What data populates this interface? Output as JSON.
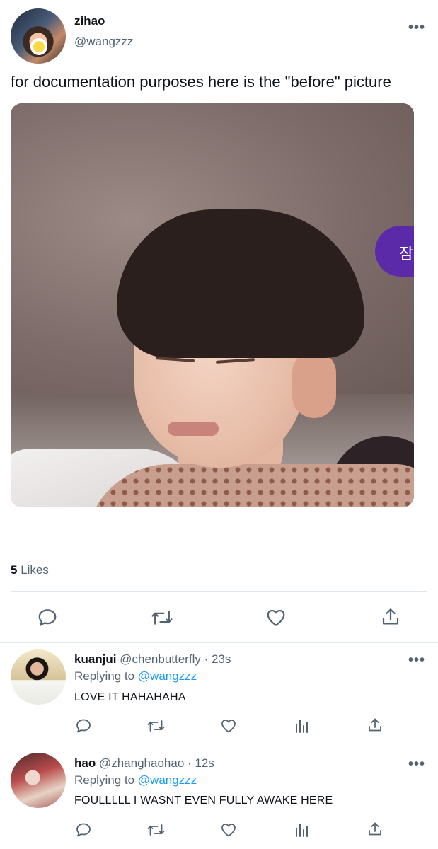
{
  "tweet": {
    "name": "zihao",
    "handle": "@wangzzz",
    "text": "for documentation purposes here is the \"before\" picture",
    "media_overlay_text": "잠",
    "likes_count": "5",
    "likes_label": "Likes",
    "more_label": "•••"
  },
  "actions": [
    "reply-icon",
    "retweet-icon",
    "like-icon",
    "share-icon"
  ],
  "replies": [
    {
      "name": "kuanjui",
      "handle": "@chenbutterfly",
      "time": "· 23s",
      "replying_label": "Replying to",
      "replying_to": "@wangzzz",
      "text": "LOVE IT HAHAHAHA",
      "more_label": "•••"
    },
    {
      "name": "hao",
      "handle": "@zhanghaohao",
      "time": "· 12s",
      "replying_label": "Replying to",
      "replying_to": "@wangzzz",
      "text": "FOULLLLL I WASNT EVEN FULLY AWAKE HERE",
      "more_label": "•••"
    }
  ],
  "colors": {
    "accent": "#1d9bf0",
    "secondary_text": "#536471",
    "divider": "#e1e8ed"
  }
}
